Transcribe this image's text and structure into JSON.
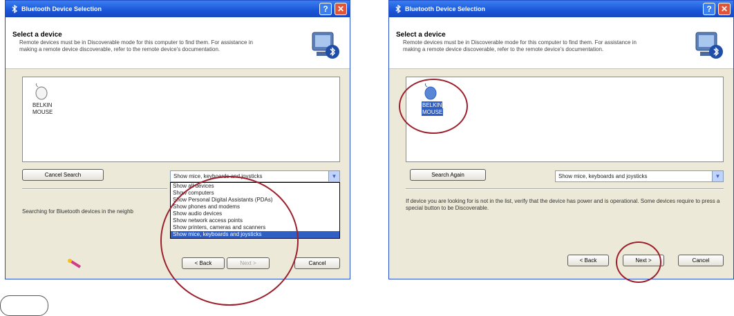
{
  "colors": {
    "title_bar": "#1a55d8",
    "highlight": "#2f5fc3",
    "annotation_circle": "#9c1f2b",
    "dialog_bg": "#ece9d8"
  },
  "left_dialog": {
    "title": "Bluetooth Device Selection",
    "help_glyph": "?",
    "close_glyph": "✕",
    "header_title": "Select a device",
    "header_desc": "Remote devices must be in Discoverable mode for this computer to find them. For assistance in making a remote device discoverable, refer to the remote device's documentation.",
    "device_label_1": "BELKIN",
    "device_label_2": "MOUSE",
    "cancel_search_label": "Cancel Search",
    "filter_selected": "Show mice, keyboards and joysticks",
    "status_text": "Searching for Bluetooth devices in the neighb",
    "dropdown_options": [
      "Show all devices",
      "Show computers",
      "Show Personal Digital Assistants (PDAs)",
      "Show phones and modems",
      "Show audio devices",
      "Show network access points",
      "Show printers, cameras and scanners",
      "Show mice, keyboards and joysticks"
    ],
    "back_label": "< Back",
    "next_label": "Next >",
    "cancel_label": "Cancel"
  },
  "right_dialog": {
    "title": "Bluetooth Device Selection",
    "help_glyph": "?",
    "close_glyph": "✕",
    "header_title": "Select a device",
    "header_desc": "Remote devices must be in Discoverable mode for this computer to find them. For assistance in making a remote device discoverable, refer to the remote device's documentation.",
    "device_label_1": "BELKIN",
    "device_label_2": "MOUSE",
    "search_again_label": "Search Again",
    "filter_selected": "Show mice, keyboards and joysticks",
    "info_text": "If device you are looking for is not in the list, verify that the device has power and is operational. Some devices require to press a special button to be Discoverable.",
    "back_label": "< Back",
    "next_label": "Next >",
    "cancel_label": "Cancel"
  }
}
